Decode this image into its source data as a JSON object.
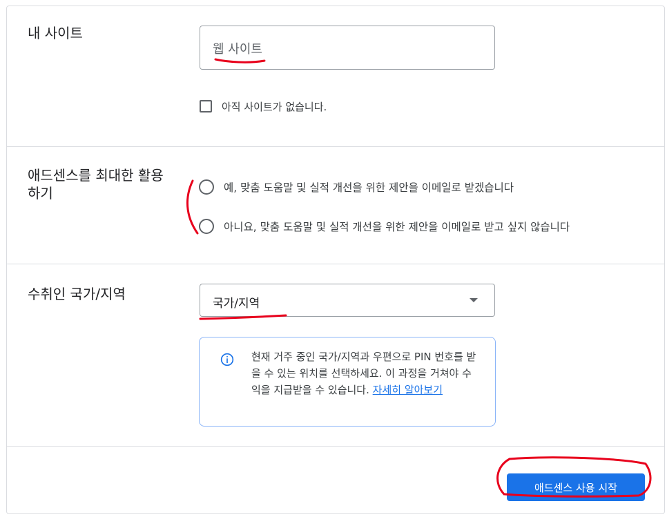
{
  "site_section": {
    "label": "내 사이트",
    "input_placeholder": "웹 사이트",
    "checkbox_label": "아직 사이트가 없습니다."
  },
  "optimize_section": {
    "label_line1": "애드센스를 최대한 활용",
    "label_line2": "하기",
    "options": [
      {
        "label": "예, 맞춤 도움말 및 실적 개선을 위한 제안을 이메일로 받겠습니다"
      },
      {
        "label": "아니요, 맞춤 도움말 및 실적 개선을 위한 제안을 이메일로 받고 싶지 않습니다"
      }
    ]
  },
  "country_section": {
    "label": "수취인 국가/지역",
    "select_value": "국가/지역",
    "info_text": "현재 거주 중인 국가/지역과 우편으로 PIN 번호를 받을 수 있는 위치를 선택하세요. 이 과정을 거쳐야 수익을 지급받을 수 있습니다. ",
    "info_link": "자세히 알아보기"
  },
  "footer": {
    "start_button": "애드센스 사용 시작"
  },
  "colors": {
    "accent": "#1a73e8",
    "annotation": "#e8001c"
  },
  "icons": {
    "info": "info-icon",
    "dropdown": "chevron-down-icon"
  }
}
